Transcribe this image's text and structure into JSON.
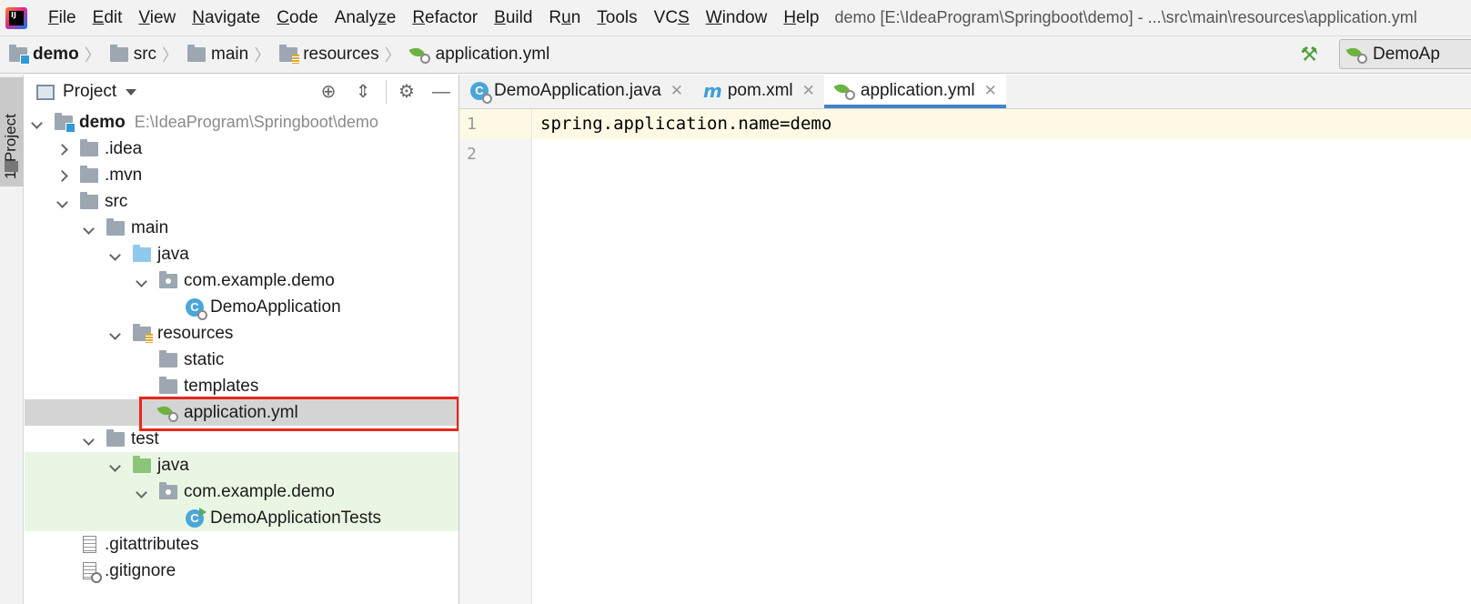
{
  "menubar": {
    "items": [
      "File",
      "Edit",
      "View",
      "Navigate",
      "Code",
      "Analyze",
      "Refactor",
      "Build",
      "Run",
      "Tools",
      "VCS",
      "Window",
      "Help"
    ],
    "mnemonics": [
      "F",
      "E",
      "V",
      "N",
      "C",
      "z",
      "R",
      "B",
      "u",
      "T",
      "S",
      "W",
      "H"
    ],
    "window_title": "demo [E:\\IdeaProgram\\Springboot\\demo] - ...\\src\\main\\resources\\application.yml"
  },
  "breadcrumb": {
    "items": [
      "demo",
      "src",
      "main",
      "resources",
      "application.yml"
    ]
  },
  "run_config": {
    "label": "DemoAp"
  },
  "tool_stripe": {
    "label": "1: Project"
  },
  "project_panel": {
    "title": "Project",
    "tree": [
      {
        "label": "demo",
        "path": "E:\\IdeaProgram\\Springboot\\demo"
      },
      {
        "label": ".idea"
      },
      {
        "label": ".mvn"
      },
      {
        "label": "src"
      },
      {
        "label": "main"
      },
      {
        "label": "java"
      },
      {
        "label": "com.example.demo"
      },
      {
        "label": "DemoApplication"
      },
      {
        "label": "resources"
      },
      {
        "label": "static"
      },
      {
        "label": "templates"
      },
      {
        "label": "application.yml"
      },
      {
        "label": "test"
      },
      {
        "label": "java"
      },
      {
        "label": "com.example.demo"
      },
      {
        "label": "DemoApplicationTests"
      },
      {
        "label": ".gitattributes"
      },
      {
        "label": ".gitignore"
      }
    ]
  },
  "editor": {
    "tabs": [
      {
        "label": "DemoApplication.java",
        "close": "✕"
      },
      {
        "label": "pom.xml",
        "close": "✕"
      },
      {
        "label": "application.yml",
        "close": "✕"
      }
    ],
    "active_tab": "application.yml",
    "line_numbers": [
      "1",
      "2"
    ],
    "lines": [
      "spring.application.name=demo",
      ""
    ]
  },
  "colors": {
    "selection_outline": "#e8261c",
    "active_tab_underline": "#4083c9",
    "current_line": "#fdf9e4",
    "test_tree_background": "#eaf6e4"
  }
}
